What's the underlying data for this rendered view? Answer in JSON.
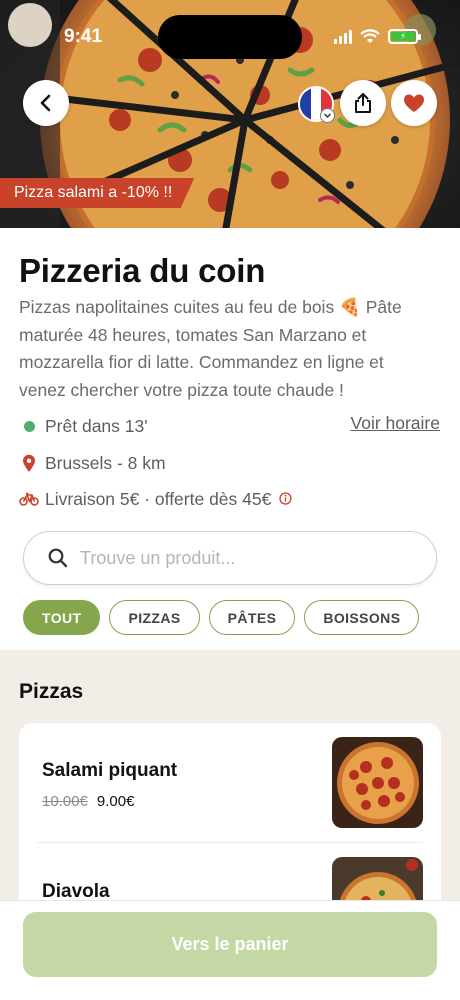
{
  "status_bar": {
    "time": "9:41"
  },
  "hero": {
    "promo_banner": "Pizza salami a -10% !!",
    "flag_colors": [
      "#1f3fa6",
      "#ffffff",
      "#e2343b"
    ],
    "accent": "#c8432a"
  },
  "restaurant": {
    "name": "Pizzeria du coin",
    "description": "Pizzas napolitaines cuites au feu de bois 🍕 Pâte maturée 48 heures, tomates San Marzano et mozzarella fior di latte. Commandez en ligne et venez chercher votre pizza toute chaude !",
    "ready_time": "Prêt dans 13'",
    "hours_link": "Voir horaire",
    "location": "Brussels - 8 km",
    "delivery": "Livraison 5€ · offerte dès 45€"
  },
  "search": {
    "placeholder": "Trouve un produit..."
  },
  "categories": [
    {
      "label": "TOUT",
      "active": true
    },
    {
      "label": "PIZZAS",
      "active": false
    },
    {
      "label": "PÂTES",
      "active": false
    },
    {
      "label": "BOISSONS",
      "active": false
    }
  ],
  "menu": {
    "section_title": "Pizzas",
    "items": [
      {
        "name": "Salami piquant",
        "old_price": "10.00€",
        "price": "9.00€"
      },
      {
        "name": "Diavola"
      }
    ]
  },
  "cart": {
    "label": "Vers le panier"
  },
  "colors": {
    "brand_green": "#86a64d",
    "cart_button": "#c5d7a5",
    "status_green": "#4eaf6b",
    "location_red": "#c8432a",
    "menu_background": "#f2ede6"
  }
}
